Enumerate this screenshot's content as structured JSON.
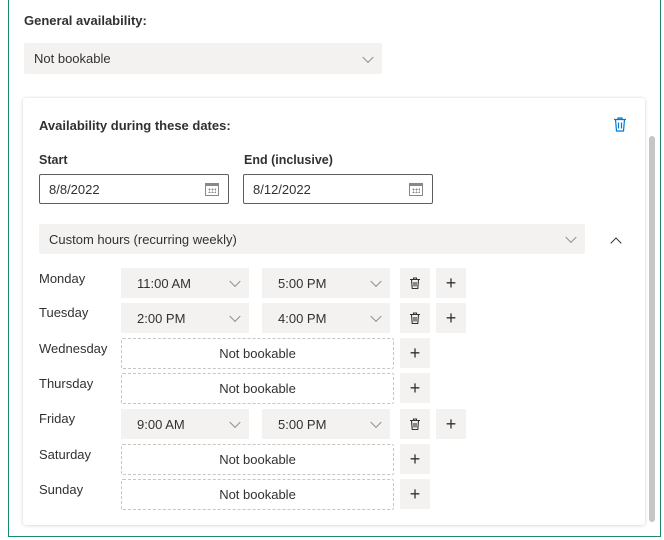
{
  "general": {
    "label": "General availability:",
    "selected": "Not bookable"
  },
  "range": {
    "title": "Availability during these dates:",
    "start_label": "Start",
    "end_label": "End (inclusive)",
    "start_value": "8/8/2022",
    "end_value": "8/12/2022",
    "hours_mode": "Custom hours (recurring weekly)"
  },
  "days": [
    {
      "name": "Monday",
      "from": "11:00 AM",
      "to": "5:00 PM"
    },
    {
      "name": "Tuesday",
      "from": "2:00 PM",
      "to": "4:00 PM"
    },
    {
      "name": "Wednesday",
      "status": "Not bookable"
    },
    {
      "name": "Thursday",
      "status": "Not bookable"
    },
    {
      "name": "Friday",
      "from": "9:00 AM",
      "to": "5:00 PM"
    },
    {
      "name": "Saturday",
      "status": "Not bookable"
    },
    {
      "name": "Sunday",
      "status": "Not bookable"
    }
  ],
  "icons": {
    "plus": "+",
    "delete": "trash-icon",
    "calendar": "calendar-icon"
  },
  "colors": {
    "accent": "#0078d4",
    "frame_border": "#1e8a6e",
    "field_bg": "#f3f2f1"
  }
}
